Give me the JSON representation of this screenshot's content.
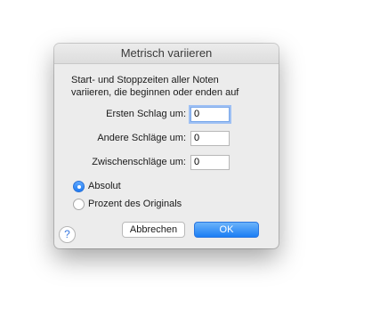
{
  "dialog": {
    "title": "Metrisch variieren",
    "description_line1": "Start- und Stoppzeiten aller Noten",
    "description_line2": "variieren, die beginnen oder enden auf",
    "fields": [
      {
        "label": "Ersten Schlag um:",
        "value": "0",
        "focused": true
      },
      {
        "label": "Andere Schläge um:",
        "value": "0",
        "focused": false
      },
      {
        "label": "Zwischenschläge um:",
        "value": "0",
        "focused": false
      }
    ],
    "radios": [
      {
        "label": "Absolut",
        "selected": true
      },
      {
        "label": "Prozent des Originals",
        "selected": false
      }
    ],
    "help_icon": "?",
    "cancel_label": "Abbrechen",
    "ok_label": "OK"
  },
  "colors": {
    "accent": "#1f7bf2",
    "dialog_bg": "#ececec"
  }
}
